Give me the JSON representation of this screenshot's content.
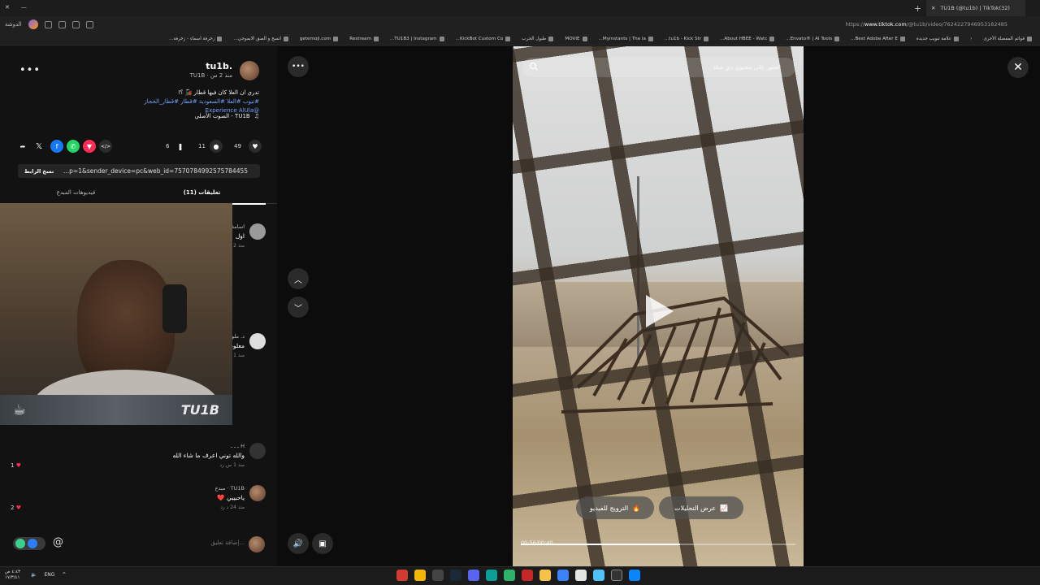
{
  "browser": {
    "tab_title": "TU1B (@tu1b) | TikTok(32)",
    "url_prefix": "https://",
    "url_host": "www.tiktok.com",
    "url_path": "/@tu1b/video/7624227946953182485",
    "profile_label": "الدوشة"
  },
  "bookmarks": [
    "قوائم المفضلة الأخرى",
    "علامة تبويب جديدة",
    "Best Adobe After E...",
    "Envato® | AI Tools...",
    "About HBEE - Watc...",
    "tu1b - Kick Str...",
    "Myinstants | The la...",
    "MOVIE",
    "طبول الحرب",
    "KickBot Custom Co...",
    "TU1B3 | Instagram...",
    "Restream",
    "getemoji.com",
    "انسخ و الصق الايموجي...",
    "زخرفة اسماء - زخرفة..."
  ],
  "post": {
    "author_name": "tu1b.",
    "author_sub": "TU1B · منذ 2 س",
    "description": "تدري ان العلا كان فيها قطار 🚂 ؟!",
    "hashtags": "#تيوب #العلا #السعودية #قطار #قطار_الحجاز",
    "mention": "@Experience AlUla",
    "music": "الصوت الأصلي - TU1B",
    "likes": "49",
    "comments": "11",
    "saves": "6",
    "link": "...p=1&sender_device=pc&web_id=7570784992575784455",
    "copy_link_label": "نسخ الرابط",
    "more_label": "•••"
  },
  "tabs": {
    "comments": "تعليقات (11)",
    "creator_videos": "فيديوهات المبدع"
  },
  "comments": [
    {
      "name": "اسامة",
      "text": "اول",
      "meta": "منذ 2",
      "likes": ""
    },
    {
      "name": "د. ملو",
      "text": "معلومه",
      "meta": "منذ 1",
      "likes": ""
    },
    {
      "name": "H ـ ـ ـ",
      "text": "والله توني اعرف ما شاء الله",
      "meta": "منذ 1 س  رد",
      "likes": "1"
    },
    {
      "name": "TU1B · مبدع",
      "text": "ياحبيبي ❤️",
      "meta": "منذ 24 د  رد",
      "likes": "2"
    }
  ],
  "webcam": {
    "overlay_text": "TU1B"
  },
  "comment_input": {
    "placeholder": "إضافة تعليق...",
    "mention_symbol": "@"
  },
  "video": {
    "search_placeholder": "العثور على محتوى ذي صلة",
    "analytics_label": "عرض التحليلات",
    "promote_label": "الترويج للفيديو",
    "time": "00:56/00:40",
    "progress_fraction": 0.58
  },
  "taskbar": {
    "time": "٤:٤٣ ص",
    "date": "١٧/٣/٤١",
    "lang": "ENG"
  }
}
